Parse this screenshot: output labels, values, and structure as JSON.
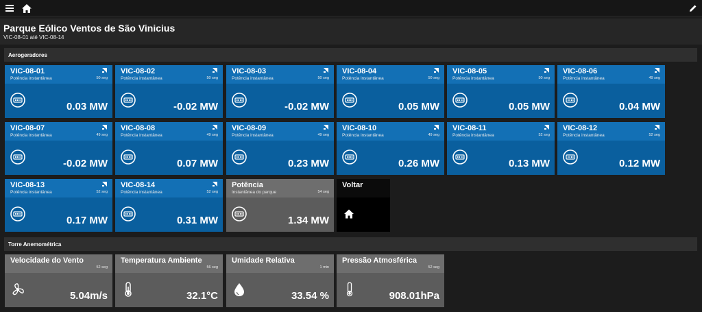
{
  "header": {
    "title": "Parque Eólico Ventos de São Vinicius",
    "subtitle": "VIC-08-01 até VIC-08-14"
  },
  "sections": {
    "turbines": "Aerogeradores",
    "tower": "Torre Anemométrica"
  },
  "turbines": [
    {
      "name": "VIC-08-01",
      "label": "Potência instantânea",
      "time": "50 seg",
      "value": "0.03 MW"
    },
    {
      "name": "VIC-08-02",
      "label": "Potência instantânea",
      "time": "50 seg",
      "value": "-0.02 MW"
    },
    {
      "name": "VIC-08-03",
      "label": "Potência instantânea",
      "time": "50 seg",
      "value": "-0.02 MW"
    },
    {
      "name": "VIC-08-04",
      "label": "Potência instantânea",
      "time": "50 seg",
      "value": "0.05 MW"
    },
    {
      "name": "VIC-08-05",
      "label": "Potência instantânea",
      "time": "50 seg",
      "value": "0.05 MW"
    },
    {
      "name": "VIC-08-06",
      "label": "Potência instantânea",
      "time": "49 seg",
      "value": "0.04 MW"
    },
    {
      "name": "VIC-08-07",
      "label": "Potência instantânea",
      "time": "49 seg",
      "value": "-0.02 MW"
    },
    {
      "name": "VIC-08-08",
      "label": "Potência instantânea",
      "time": "49 seg",
      "value": "0.07 MW"
    },
    {
      "name": "VIC-08-09",
      "label": "Potência instantânea",
      "time": "49 seg",
      "value": "0.23 MW"
    },
    {
      "name": "VIC-08-10",
      "label": "Potência instantânea",
      "time": "49 seg",
      "value": "0.26 MW"
    },
    {
      "name": "VIC-08-11",
      "label": "Potência instantânea",
      "time": "52 seg",
      "value": "0.13 MW"
    },
    {
      "name": "VIC-08-12",
      "label": "Potência instantânea",
      "time": "52 seg",
      "value": "0.12 MW"
    },
    {
      "name": "VIC-08-13",
      "label": "Potência instantânea",
      "time": "52 seg",
      "value": "0.17 MW"
    },
    {
      "name": "VIC-08-14",
      "label": "Potência instantânea",
      "time": "52 seg",
      "value": "0.31 MW"
    }
  ],
  "park_power": {
    "name": "Potência",
    "label": "Instantânea do parque",
    "time": "54 seg",
    "value": "1.34 MW"
  },
  "back": {
    "label": "Voltar"
  },
  "tower": [
    {
      "name": "Velocidade do Vento",
      "time": "52 seg",
      "value": "5.04m/s",
      "icon": "fan-icon"
    },
    {
      "name": "Temperatura Ambiente",
      "time": "56 seg",
      "value": "32.1°C",
      "icon": "thermometer-icon"
    },
    {
      "name": "Umidade Relativa",
      "time": "1 min",
      "value": "33.54 %",
      "icon": "drop-icon"
    },
    {
      "name": "Pressão Atmosférica",
      "time": "52 seg",
      "value": "908.01hPa",
      "icon": "gauge-icon"
    }
  ],
  "colors": {
    "tile_blue": "#0a5f9e",
    "tile_blue_header": "#1370b5",
    "tile_gray": "#5c5c5c",
    "background": "#1c1c1c"
  }
}
